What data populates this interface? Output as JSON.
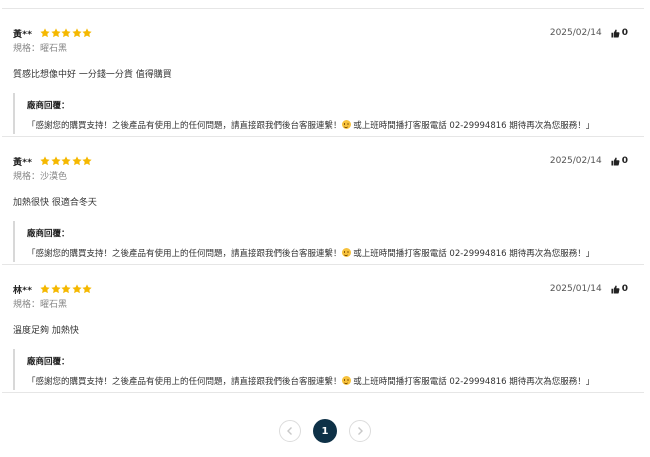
{
  "colors": {
    "star": "#f5b800",
    "page_active": "#0e3147"
  },
  "reviews": [
    {
      "reviewer": "黃**",
      "rating": 5,
      "date": "2025/02/14",
      "likes": "0",
      "spec_label": "規格：",
      "spec_value": "曜石黑",
      "text": "質感比想像中好 一分錢一分貨 值得購買",
      "reply_title": "廠商回覆：",
      "reply_before": "「感謝您的購買支持！之後產品有使用上的任何問題，請直接跟我們後台客服連繫！",
      "reply_after": " 或上班時間播打客服電話 02-29994816 期待再次為您服務！」"
    },
    {
      "reviewer": "黃**",
      "rating": 5,
      "date": "2025/02/14",
      "likes": "0",
      "spec_label": "規格：",
      "spec_value": "沙漠色",
      "text": "加熱很快 很適合冬天",
      "reply_title": "廠商回覆：",
      "reply_before": "「感謝您的購買支持！之後產品有使用上的任何問題，請直接跟我們後台客服連繫！",
      "reply_after": " 或上班時間播打客服電話 02-29994816 期待再次為您服務！」"
    },
    {
      "reviewer": "林**",
      "rating": 5,
      "date": "2025/01/14",
      "likes": "0",
      "spec_label": "規格：",
      "spec_value": "曜石黑",
      "text": "溫度足夠 加熱快",
      "reply_title": "廠商回覆：",
      "reply_before": "「感謝您的購買支持！之後產品有使用上的任何問題，請直接跟我們後台客服連繫！",
      "reply_after": " 或上班時間播打客服電話 02-29994816 期待再次為您服務！」"
    }
  ],
  "pagination": {
    "current_page": "1",
    "prev_icon": "chevron-left-icon",
    "next_icon": "chevron-right-icon"
  },
  "icons": {
    "star": "star-icon",
    "like": "thumbs-up-icon",
    "emoji": "smiling-face-emoji"
  }
}
